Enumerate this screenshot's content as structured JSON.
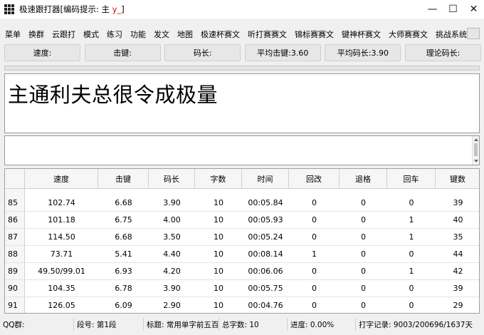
{
  "window": {
    "title_prefix": "极速跟打器[编码提示: 主 ",
    "title_hint": "y_",
    "title_suffix": "]",
    "minimize": "—",
    "maximize": "☐",
    "close": "✕"
  },
  "menu": [
    "菜单",
    "换群",
    "云跟打",
    "模式",
    "练习",
    "功能",
    "发文",
    "地图",
    "极速杯赛文",
    "听打赛赛文",
    "锦标赛赛文",
    "键神杯赛文",
    "大师赛赛文",
    "挑战系统"
  ],
  "stats": {
    "speed": "速度:",
    "keystroke": "击键:",
    "code_length": "码长:",
    "avg_keystroke": "平均击键:3.60",
    "avg_code_length": "平均码长:3.90",
    "theory_code_length": "理论码长:"
  },
  "article_text": "主通利夫总很令成极量",
  "table": {
    "headers": [
      "速度",
      "击键",
      "码长",
      "字数",
      "时间",
      "回改",
      "退格",
      "回车",
      "键数"
    ],
    "rows": [
      [
        "85",
        "102.74",
        "6.68",
        "3.90",
        "10",
        "00:05.84",
        "0",
        "0",
        "0",
        "39"
      ],
      [
        "86",
        "101.18",
        "6.75",
        "4.00",
        "10",
        "00:05.93",
        "0",
        "0",
        "1",
        "40"
      ],
      [
        "87",
        "114.50",
        "6.68",
        "3.50",
        "10",
        "00:05.24",
        "0",
        "0",
        "1",
        "35"
      ],
      [
        "88",
        "73.71",
        "5.41",
        "4.40",
        "10",
        "00:08.14",
        "1",
        "0",
        "0",
        "44"
      ],
      [
        "89",
        "49.50/99.01",
        "6.93",
        "4.20",
        "10",
        "00:06.06",
        "0",
        "0",
        "1",
        "42"
      ],
      [
        "90",
        "104.35",
        "6.78",
        "3.90",
        "10",
        "00:05.75",
        "0",
        "0",
        "0",
        "39"
      ],
      [
        "91",
        "126.05",
        "6.09",
        "2.90",
        "10",
        "00:04.76",
        "0",
        "0",
        "0",
        "29"
      ]
    ]
  },
  "status": {
    "qq_group": "QQ群:",
    "segment": "段号: 第1段",
    "title": "标题: 常用单字前五百",
    "total_chars": "总字数: 10",
    "progress": "进度: 0.00%",
    "record": "打字记录: 9003/200696/1637天"
  }
}
